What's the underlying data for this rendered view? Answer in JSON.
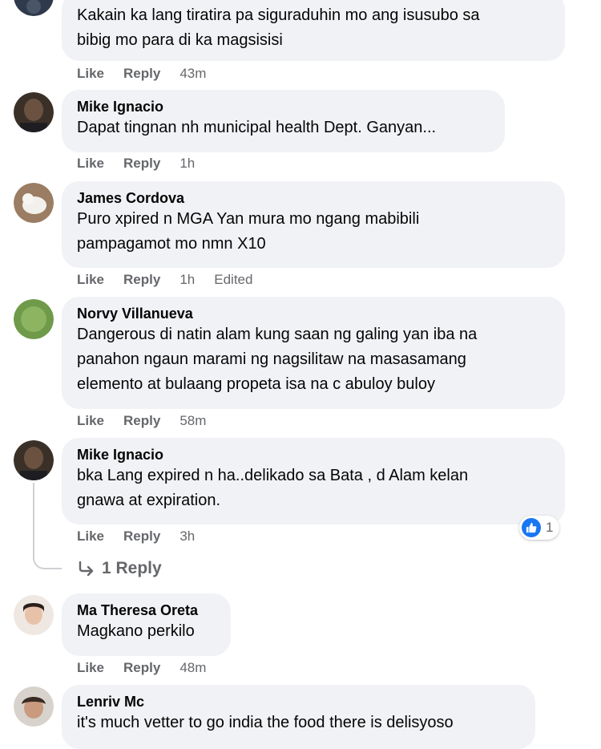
{
  "comments": [
    {
      "author": "",
      "lines": [
        "Kakain ka lang tiratira pa siguraduhin mo ang isusubo sa",
        "bibig mo para di ka magsisisi"
      ],
      "actions": {
        "like": "Like",
        "reply": "Reply",
        "time": "43m"
      }
    },
    {
      "author": "Mike Ignacio",
      "lines": [
        "Dapat tingnan nh municipal health Dept. Ganyan..."
      ],
      "actions": {
        "like": "Like",
        "reply": "Reply",
        "time": "1h"
      }
    },
    {
      "author": "James Cordova",
      "lines": [
        "Puro xpired n MGA Yan mura mo ngang mabibili",
        "pampagamot mo nmn X10"
      ],
      "actions": {
        "like": "Like",
        "reply": "Reply",
        "time": "1h",
        "edited": "Edited"
      }
    },
    {
      "author": "Norvy Villanueva",
      "lines": [
        "Dangerous di natin alam kung saan ng galing yan iba na",
        "panahon ngaun marami ng nagsilitaw na masasamang",
        "elemento at bulaang propeta isa na c abuloy buloy"
      ],
      "actions": {
        "like": "Like",
        "reply": "Reply",
        "time": "58m"
      }
    },
    {
      "author": "Mike Ignacio",
      "lines": [
        "bka Lang expired n ha..delikado sa Bata , d Alam kelan",
        "gnawa at expiration."
      ],
      "actions": {
        "like": "Like",
        "reply": "Reply",
        "time": "3h"
      },
      "reaction_count": "1",
      "replies_link": "1 Reply"
    },
    {
      "author": "Ma Theresa Oreta",
      "lines": [
        "Magkano perkilo"
      ],
      "actions": {
        "like": "Like",
        "reply": "Reply",
        "time": "48m"
      }
    },
    {
      "author": "Lenriv Mc",
      "lines": [
        "it's much vetter to go india the food there is delisyoso"
      ]
    }
  ],
  "colors": {
    "bubble": "#f0f2f5",
    "meta": "#65676b",
    "like_blue": "#1877f2"
  }
}
